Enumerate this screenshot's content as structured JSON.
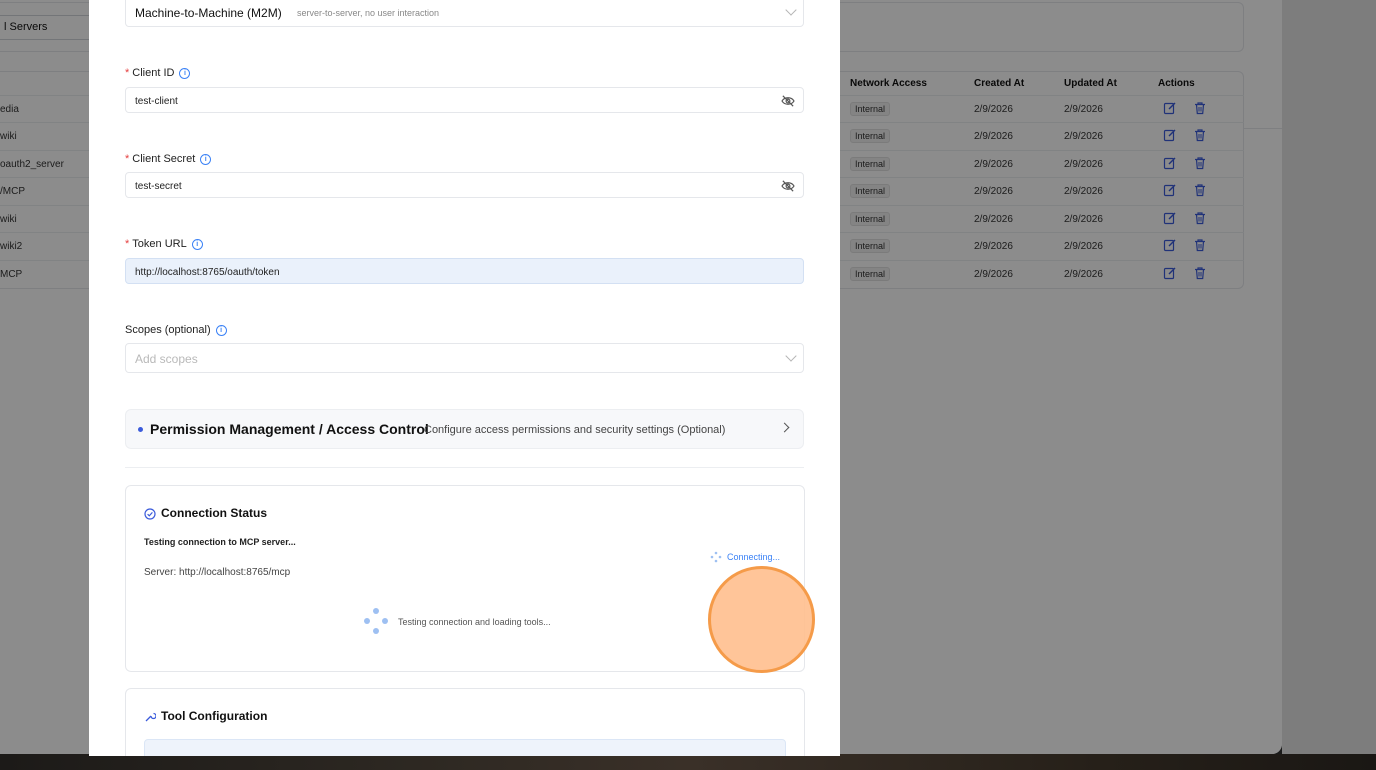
{
  "background_app": {
    "header_tab_label": "l Servers",
    "columns": [
      "Network Access",
      "Created At",
      "Updated At",
      "Actions"
    ],
    "name_fragments": [
      "edia",
      "wiki",
      "oauth2_server",
      "/MCP",
      "wiki",
      "wiki2",
      "MCP"
    ],
    "rows": [
      {
        "network": "Internal",
        "created": "2/9/2026",
        "updated": "2/9/2026"
      },
      {
        "network": "Internal",
        "created": "2/9/2026",
        "updated": "2/9/2026"
      },
      {
        "network": "Internal",
        "created": "2/9/2026",
        "updated": "2/9/2026"
      },
      {
        "network": "Internal",
        "created": "2/9/2026",
        "updated": "2/9/2026"
      },
      {
        "network": "Internal",
        "created": "2/9/2026",
        "updated": "2/9/2026"
      },
      {
        "network": "Internal",
        "created": "2/9/2026",
        "updated": "2/9/2026"
      },
      {
        "network": "Internal",
        "created": "2/9/2026",
        "updated": "2/9/2026"
      }
    ]
  },
  "modal": {
    "auth_type": {
      "value": "Machine-to-Machine (M2M)",
      "hint": "server-to-server, no user interaction"
    },
    "client_id": {
      "label": "Client ID",
      "value": "test-client"
    },
    "client_secret": {
      "label": "Client Secret",
      "value": "test-secret"
    },
    "token_url": {
      "label": "Token URL",
      "value": "http://localhost:8765/oauth/token"
    },
    "scopes": {
      "label": "Scopes (optional)",
      "placeholder": "Add scopes"
    },
    "permission": {
      "title": "Permission Management / Access Control",
      "description": "Configure access permissions and security settings (Optional)"
    },
    "connection": {
      "title": "Connection Status",
      "testing_text": "Testing connection to MCP server...",
      "connecting_label": "Connecting...",
      "server_text": "Server: http://localhost:8765/mcp",
      "loading_text": "Testing connection and loading tools..."
    },
    "tool_config": {
      "title": "Tool Configuration"
    }
  },
  "colors": {
    "accent": "#3b82f6",
    "cursor_fill": "#ffbf8e",
    "cursor_ring": "#f59b49",
    "required": "#e53e3e"
  },
  "required_mark": "*"
}
